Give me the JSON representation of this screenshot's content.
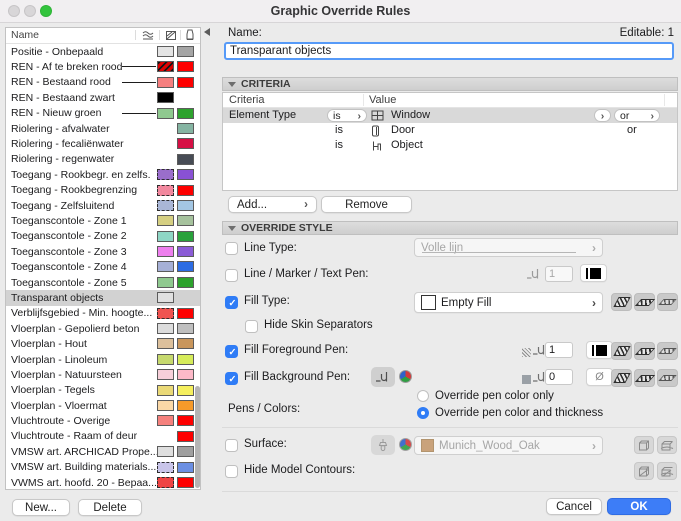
{
  "window": {
    "title": "Graphic Override Rules"
  },
  "list": {
    "name_header": "Name",
    "header_icons": [
      "line-type-icon",
      "fill-pen-icon",
      "background-pen-icon"
    ],
    "rows": [
      {
        "label": "Positie - Onbepaald",
        "line": false,
        "fg": "#e4e4e4",
        "bg": "#a5a5a5"
      },
      {
        "label": "REN - Af te breken rood",
        "line": true,
        "fg": "#e00000",
        "fg_hatch": true,
        "bg": "#fe0000"
      },
      {
        "label": "REN - Bestaand rood",
        "line": true,
        "fg": "#f57f7f",
        "bg": "#fe0000"
      },
      {
        "label": "REN - Bestaand zwart",
        "line": false,
        "fg": "#000000",
        "bg": null
      },
      {
        "label": "REN - Nieuw groen",
        "line": true,
        "fg": "#8fc98f",
        "bg": "#2da22d"
      },
      {
        "label": "Riolering - afvalwater",
        "fg": null,
        "bg": "#85b4a2"
      },
      {
        "label": "Riolering - fecaliënwater",
        "fg": null,
        "bg": "#d60f44"
      },
      {
        "label": "Riolering - regenwater",
        "fg": null,
        "bg": "#474c55"
      },
      {
        "label": "Toegang  - Rookbegr. en zelfs.",
        "fg": "#9a6ecb",
        "fg_dashed": true,
        "bg": "#8951d4"
      },
      {
        "label": "Toegang  - Rookbegrenzing",
        "fg": "#f2889e",
        "fg_dashed": true,
        "bg": "#fe0000"
      },
      {
        "label": "Toegang - Zelfsluitend",
        "fg": "#a9b6d6",
        "fg_dashed": true,
        "bg": "#a3c6e3"
      },
      {
        "label": "Toeganscontole - Zone 1",
        "fg": "#d5cf82",
        "bg": "#a6c29d"
      },
      {
        "label": "Toeganscontole - Zone 2",
        "fg": "#8ed6c5",
        "bg": "#29a13b"
      },
      {
        "label": "Toeganscontole - Zone 3",
        "fg": "#ee7fee",
        "bg": "#8b5cd6"
      },
      {
        "label": "Toeganscontole - Zone 4",
        "fg": "#a6b0d6",
        "bg": "#2c6ce3"
      },
      {
        "label": "Toeganscontole - Zone 5",
        "fg": "#8fc98f",
        "bg": "#2da22d"
      },
      {
        "label": "Transparant objects",
        "fg": "#e0e0e0",
        "bg": null,
        "selected": true
      },
      {
        "label": "Verblijfsgebied - Min. hoogte...",
        "fg": "#ef5350",
        "fg_dashed": true,
        "bg": "#fe0000"
      },
      {
        "label": "Vloerplan - Gepolierd beton",
        "fg": "#dcdcdc",
        "bg": "#bfbfbf"
      },
      {
        "label": "Vloerplan - Hout",
        "fg": "#dcc09c",
        "bg": "#c9965c"
      },
      {
        "label": "Vloerplan - Linoleum",
        "fg": "#c6d96e",
        "bg": "#d6ec5a"
      },
      {
        "label": "Vloerplan - Natuursteen",
        "fg": "#f7cfd9",
        "bg": "#fdb9c8"
      },
      {
        "label": "Vloerplan - Tegels",
        "fg": "#ead977",
        "bg": "#f5ef5e"
      },
      {
        "label": "Vloerplan - Vloermat",
        "fg": "#fbd8a6",
        "bg": "#f69a2a"
      },
      {
        "label": "Vluchtroute - Overige",
        "fg": "#f5817d",
        "bg": "#fe0000"
      },
      {
        "label": "Vluchtroute - Raam of deur",
        "fg": null,
        "bg": "#fe0000"
      },
      {
        "label": "VMSW art. ARCHICAD Prope...",
        "fg": "#dfdfdf",
        "bg": "#9f9f9f"
      },
      {
        "label": "VMSW art. Building materials...",
        "fg": "#c9c5ea",
        "fg_dashed": true,
        "bg": "#6b8fe3"
      },
      {
        "label": "VWMS art. hoofd. 20 - Bepaa...",
        "fg": "#ef4444",
        "fg_dashed": true,
        "bg": "#fe0000"
      }
    ],
    "new_button": "New...",
    "delete_button": "Delete"
  },
  "detail": {
    "name_label": "Name:",
    "editable_label": "Editable: 1",
    "name_value": "Transparant objects",
    "criteria": {
      "title": "CRITERIA",
      "columns": {
        "criteria": "Criteria",
        "value": "Value"
      },
      "rows": [
        {
          "criteria": "Element Type",
          "operator": "is",
          "value": "Window",
          "icon": "window-icon",
          "join": "or",
          "selected": true
        },
        {
          "criteria": "",
          "operator": "is",
          "value": "Door",
          "icon": "door-icon",
          "join": "or"
        },
        {
          "criteria": "",
          "operator": "is",
          "value": "Object",
          "icon": "object-icon",
          "join": ""
        }
      ],
      "add_button": "Add...",
      "remove_button": "Remove"
    },
    "override": {
      "title": "OVERRIDE STYLE",
      "line_type_label": "Line Type:",
      "line_type_value": "Volle lijn",
      "line_type_checked": false,
      "line_pen_label": "Line / Marker / Text Pen:",
      "line_pen_value": "1",
      "line_pen_checked": false,
      "fill_type_label": "Fill Type:",
      "fill_type_value": "Empty Fill",
      "fill_type_checked": true,
      "hide_skin_label": "Hide Skin Separators",
      "hide_skin_checked": false,
      "fill_fg_label": "Fill Foreground Pen:",
      "fill_fg_value": "1",
      "fill_fg_checked": true,
      "fill_bg_label": "Fill Background Pen:",
      "fill_bg_value": "0",
      "fill_bg_empty": "Ø",
      "fill_bg_checked": true,
      "pens_label": "Pens / Colors:",
      "pens_options": [
        "Override pen color only",
        "Override pen color and thickness"
      ],
      "pens_selected": 1,
      "surface_label": "Surface:",
      "surface_value": "Munich_Wood_Oak",
      "surface_swatch": "#c9a27b",
      "surface_checked": false,
      "hide_contours_label": "Hide Model Contours:",
      "hide_contours_checked": false
    },
    "cancel_button": "Cancel",
    "ok_button": "OK"
  },
  "colors": {
    "accent": "#2f7cf6",
    "selection": "#d2d2d2",
    "ok_blue": "#3d7df7"
  }
}
